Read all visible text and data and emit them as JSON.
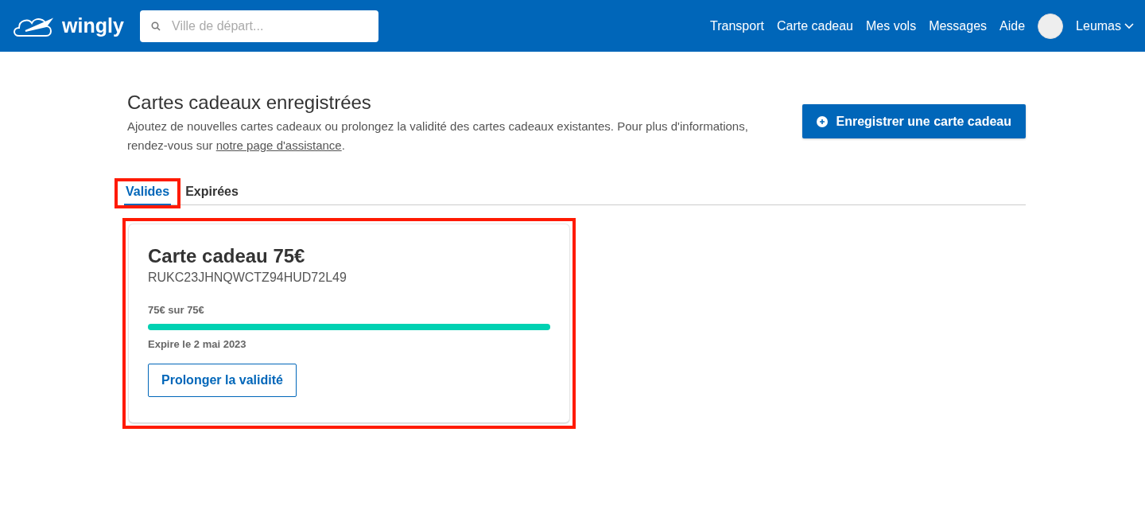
{
  "header": {
    "brand": "wingly",
    "search": {
      "placeholder": "Ville de départ..."
    },
    "nav": [
      "Transport",
      "Carte cadeau",
      "Mes vols",
      "Messages",
      "Aide"
    ],
    "user": "Leumas"
  },
  "page": {
    "title": "Cartes cadeaux enregistrées",
    "description": "Ajoutez de nouvelles cartes cadeaux ou prolongez la validité des cartes cadeaux existantes. Pour plus d'informations, rendez-vous sur",
    "link": "notre page d'assistance",
    "description_end": ".",
    "action": "Enregistrer une carte cadeau"
  },
  "tabs": [
    {
      "label": "Valides",
      "selected": true,
      "highlighted": true
    },
    {
      "label": "Expirées",
      "selected": false,
      "highlighted": false
    }
  ],
  "cards": [
    {
      "title": "Carte cadeau 75€",
      "code": "RUKC23JHNQWCTZ94HUD72L49",
      "balance": "75€ sur 75€",
      "level": 1,
      "expiry": "Expire le 2 mai 2023",
      "button": "Prolonger la validité",
      "highlighted": true
    }
  ]
}
